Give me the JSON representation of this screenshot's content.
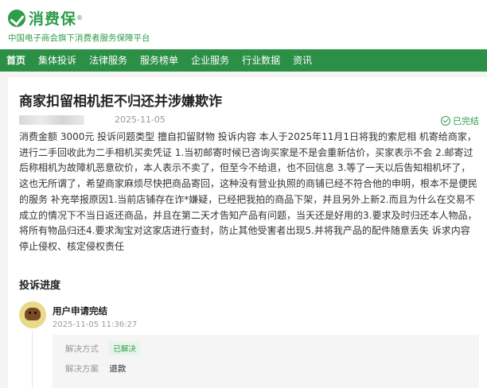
{
  "header": {
    "logo_text": "消费保",
    "logo_reg": "®",
    "slogan": "中国电子商会旗下消费者服务保障平台"
  },
  "nav": [
    "首页",
    "集体投诉",
    "法律服务",
    "服务榜单",
    "企业服务",
    "行业数据",
    "资讯"
  ],
  "complaint": {
    "title": "商家扣留相机拒不归还并涉嫌欺诈",
    "date": "2025-11-05",
    "status": "已完结",
    "content": "消费金额 3000元 投诉问题类型 擅自扣留财物 投诉内容 本人于2025年11月1日将我的索尼相 机寄给商家，进行二手回收此为二手相机买卖凭证 1.当初邮寄时候已咨询买家是不是会重新估价，买家表示不会 2.邮寄过后称相机为故障机恶意砍价，本人表示不卖了，但至今不给退，也不回信息 3.等了一天以后告知相机坏了，这也无所谓了，希望商家麻烦尽快把商品寄回，这种没有营业执照的商铺已经不符合他的申明，根本不是便民的服务 补充举报原因1.当前店铺存在诈*嫌疑，已经把我拍的商品下架，并且另外上新2.而且为什么在交易不成立的情况下不当日返还商品，并且在第二天才告知产品有问题，当天还是好用的3.要求及时归还本人物品，将所有物品归还4.要求淘宝对这家店进行查封，防止其他受害者出现5.并将我产品的配件随意丢失 诉求内容停止侵权、核定侵权责任"
  },
  "progress": {
    "section_title": "投诉进度",
    "step_title": "用户申请完结",
    "step_time": "2025-11-05 11:36:27",
    "method_label": "解决方式",
    "method_value": "已解决",
    "plan_label": "解决方案",
    "plan_value": "退款"
  },
  "colors": {
    "brand_green": "#2e9d4a",
    "nav_green": "#2b8f45"
  }
}
